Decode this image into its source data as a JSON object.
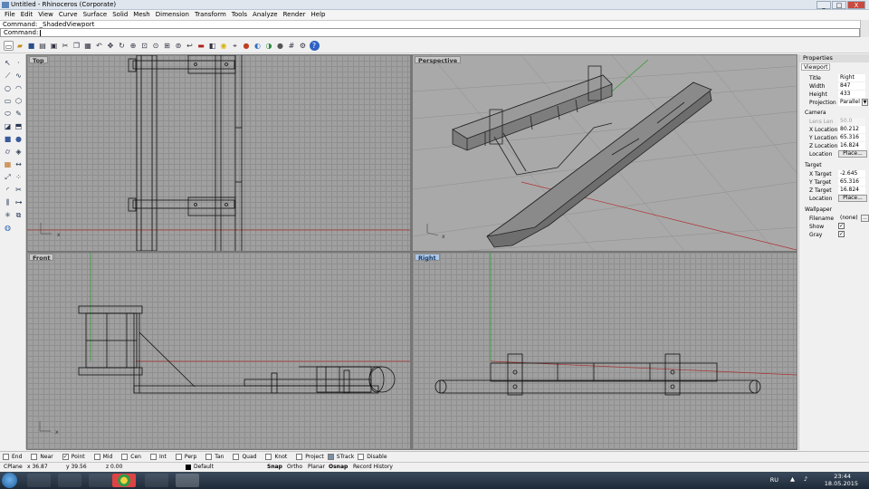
{
  "window": {
    "title": "Untitled - Rhinoceros (Corporate)",
    "buttons": [
      "_",
      "□",
      "X"
    ]
  },
  "menu": [
    "File",
    "Edit",
    "View",
    "Curve",
    "Surface",
    "Solid",
    "Mesh",
    "Dimension",
    "Transform",
    "Tools",
    "Analyze",
    "Render",
    "Help"
  ],
  "command": {
    "history": "Command: _ShadedViewport",
    "prompt": "Command:",
    "value": ""
  },
  "toolbar_icons": [
    "new-icon",
    "open-icon",
    "save-icon",
    "print-icon",
    "import-icon",
    "cut-icon",
    "copy-icon",
    "paste-icon",
    "undo-icon",
    "pan-icon",
    "rotate-icon",
    "zoom-icon",
    "zoom-window-icon",
    "zoom-target-icon",
    "zoom-extents-icon",
    "zoom-selected-icon",
    "undo-view-icon",
    "layer-icon",
    "properties-icon",
    "light-icon",
    "select-icon",
    "render-icon",
    "material-icon",
    "environment-icon",
    "sphere-icon",
    "grid-icon",
    "options-icon",
    "help-icon"
  ],
  "left_tools": [
    "select-arrow-icon",
    "points-icon",
    "polyline-icon",
    "curve-icon",
    "circle-icon",
    "arc-icon",
    "rectangle-icon",
    "polygon-icon",
    "ellipse-icon",
    "freeform-icon",
    "surface-icon",
    "extrude-icon",
    "solid-box-icon",
    "sphere-icon",
    "cylinder-icon",
    "boolean-icon",
    "mesh-icon",
    "dimension-icon",
    "transform-icon",
    "array-icon",
    "fillet-icon",
    "trim-icon",
    "split-icon",
    "join-icon",
    "explode-icon",
    "group-icon",
    "render-sphere-icon"
  ],
  "viewports": {
    "top": "Top",
    "perspective": "Perspective",
    "front": "Front",
    "right": "Right"
  },
  "properties": {
    "title": "Properties",
    "tab": "Viewport",
    "rows": [
      {
        "k": "Title",
        "v": "Right"
      },
      {
        "k": "Width",
        "v": "847"
      },
      {
        "k": "Height",
        "v": "433"
      },
      {
        "k": "Projection",
        "v": "Parallel"
      }
    ],
    "camera_label": "Camera",
    "camera": [
      {
        "k": "Lens Len",
        "v": "50.0",
        "disabled": true
      },
      {
        "k": "X Location",
        "v": "80.212"
      },
      {
        "k": "Y Location",
        "v": "65.316"
      },
      {
        "k": "Z Location",
        "v": "16.824"
      }
    ],
    "camera_place": {
      "k": "Location",
      "btn": "Place..."
    },
    "target_label": "Target",
    "target": [
      {
        "k": "X Target",
        "v": "-2.645"
      },
      {
        "k": "Y Target",
        "v": "65.316"
      },
      {
        "k": "Z Target",
        "v": "16.824"
      }
    ],
    "target_place": {
      "k": "Location",
      "btn": "Place..."
    },
    "wallpaper_label": "Wallpaper",
    "filename": {
      "k": "Filename",
      "v": "(none)",
      "btn": "..."
    },
    "show": {
      "k": "Show",
      "checked": true
    },
    "gray": {
      "k": "Gray",
      "checked": true
    }
  },
  "osnap": [
    {
      "label": "End",
      "checked": false
    },
    {
      "label": "Near",
      "checked": false
    },
    {
      "label": "Point",
      "checked": true
    },
    {
      "label": "Mid",
      "checked": false
    },
    {
      "label": "Cen",
      "checked": false
    },
    {
      "label": "Int",
      "checked": false
    },
    {
      "label": "Perp",
      "checked": false
    },
    {
      "label": "Tan",
      "checked": false
    },
    {
      "label": "Quad",
      "checked": false
    },
    {
      "label": "Knot",
      "checked": false
    },
    {
      "label": "Project",
      "checked": false
    },
    {
      "label": "STrack",
      "checked": true
    },
    {
      "label": "Disable",
      "checked": false
    }
  ],
  "status": {
    "cplane": "CPlane",
    "x": "x 36.87",
    "y": "y 39.56",
    "z": "z 0.00",
    "layer": "Default",
    "snap": "Snap",
    "ortho": "Ortho",
    "planar": "Planar",
    "osnap": "Osnap",
    "record": "Record History"
  },
  "tray": {
    "lang": "RU",
    "time": "23:44",
    "date": "18.05.2015"
  },
  "taskbar_apps": [
    "explorer-icon",
    "media-player-icon",
    "folder-icon",
    "chrome-icon",
    "word-icon",
    "rhino-icon"
  ]
}
